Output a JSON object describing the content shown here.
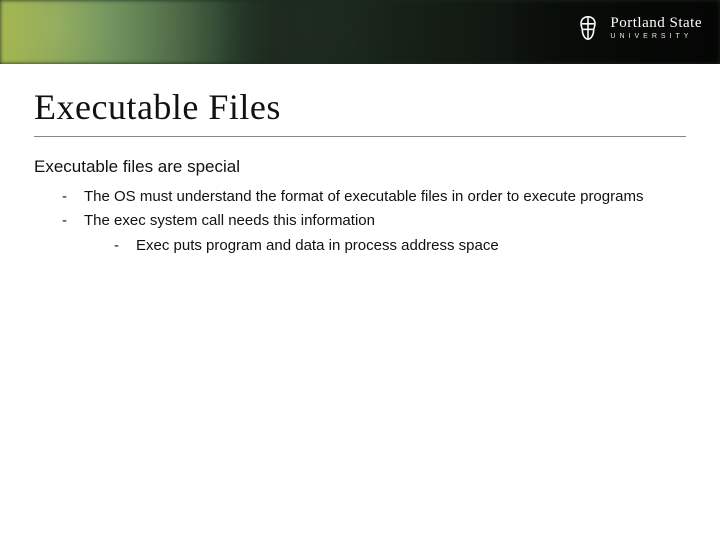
{
  "logo": {
    "line1": "Portland State",
    "line2": "UNIVERSITY"
  },
  "title": "Executable Files",
  "subhead": "Executable files are special",
  "bullets": [
    {
      "text": "The OS must understand the format of executable files in order to execute programs"
    },
    {
      "text": "The exec system call needs this information",
      "sub": [
        "Exec puts program and data in process address space"
      ]
    }
  ]
}
